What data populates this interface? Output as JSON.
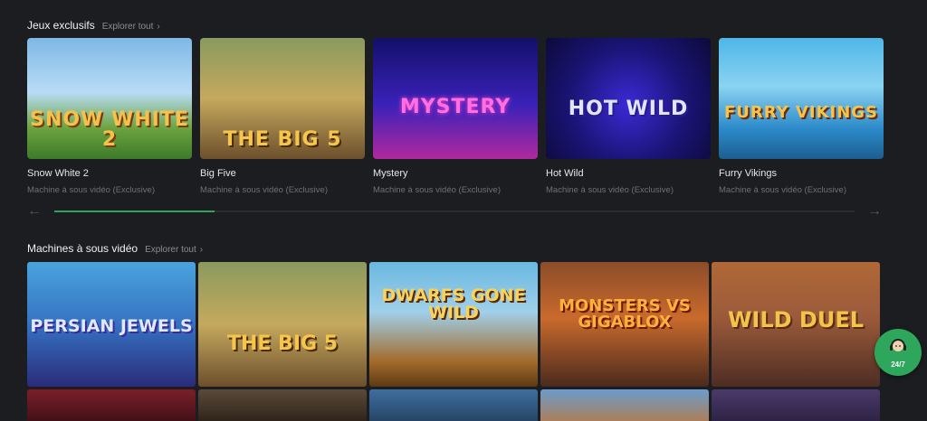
{
  "exclusive": {
    "title": "Jeux exclusifs",
    "explore": "Explorer tout",
    "games": [
      {
        "title": "Snow White 2",
        "subtitle": "Machine à sous vidéo (Exclusive)",
        "art": "SNOW WHITE 2"
      },
      {
        "title": "Big Five",
        "subtitle": "Machine à sous vidéo (Exclusive)",
        "art": "THE BIG 5"
      },
      {
        "title": "Mystery",
        "subtitle": "Machine à sous vidéo (Exclusive)",
        "art": "MYSTERY"
      },
      {
        "title": "Hot Wild",
        "subtitle": "Machine à sous vidéo (Exclusive)",
        "art": "HOT WILD"
      },
      {
        "title": "Furry Vikings",
        "subtitle": "Machine à sous vidéo (Exclusive)",
        "art": "FURRY VIKINGS"
      }
    ],
    "scroll_progress": 0.2
  },
  "video_slots": {
    "title": "Machines à sous vidéo",
    "explore": "Explorer tout",
    "games": [
      {
        "art": "PERSIAN JEWELS"
      },
      {
        "art": "THE BIG 5"
      },
      {
        "art": "DWARFS GONE WILD"
      },
      {
        "art": "MONSTERS VS GIGABLOX"
      },
      {
        "art": "WILD DUEL"
      }
    ]
  },
  "support": {
    "label": "24/7",
    "icon": "headset-icon"
  },
  "colors": {
    "background": "#1c1d20",
    "accent": "#2ea75d"
  }
}
